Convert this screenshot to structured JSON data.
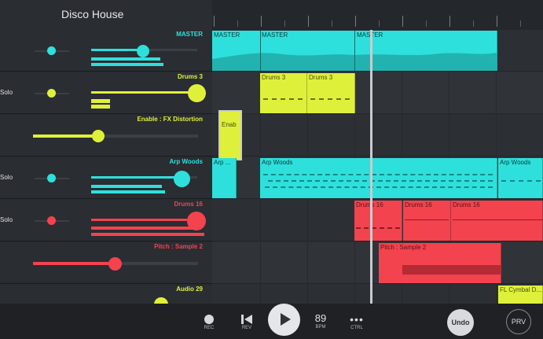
{
  "header": {
    "song_title": "Disco House"
  },
  "colors": {
    "cyan": "#2ee0dc",
    "lime": "#dff03a",
    "red": "#f2434f",
    "bg": "#1b1d21"
  },
  "mixer": {
    "master": {
      "name": "MASTER"
    },
    "drums3": {
      "name": "Drums 3",
      "solo": "Solo"
    },
    "fx": {
      "name": "Enable : FX Distortion"
    },
    "arp": {
      "name": "Arp Woods",
      "solo": "Solo"
    },
    "drums16": {
      "name": "Drums 16",
      "solo": "Solo"
    },
    "pitch": {
      "name": "Pitch : Sample 2"
    },
    "audio29": {
      "name": "Audio 29"
    }
  },
  "playlist": {
    "master_clips": [
      "MASTER",
      "MASTER",
      "MASTER"
    ],
    "drums3_clips": [
      "Drums 3",
      "Drums 3"
    ],
    "fx_clip": "Enab",
    "arp_clips": [
      "Arp ...",
      "Arp Woods",
      "Arp Woods"
    ],
    "drums16_clips": [
      "Drums 16",
      "Drums 16",
      "Drums 16"
    ],
    "pitch_clip": "Pitch : Sample 2",
    "audio_clip": "FL Cymbal D..."
  },
  "transport": {
    "rec": "REC",
    "rev": "REV",
    "bpm_value": "89",
    "bpm": "BPM",
    "ctrl": "CTRL",
    "undo": "Undo",
    "prv": "PRV"
  }
}
